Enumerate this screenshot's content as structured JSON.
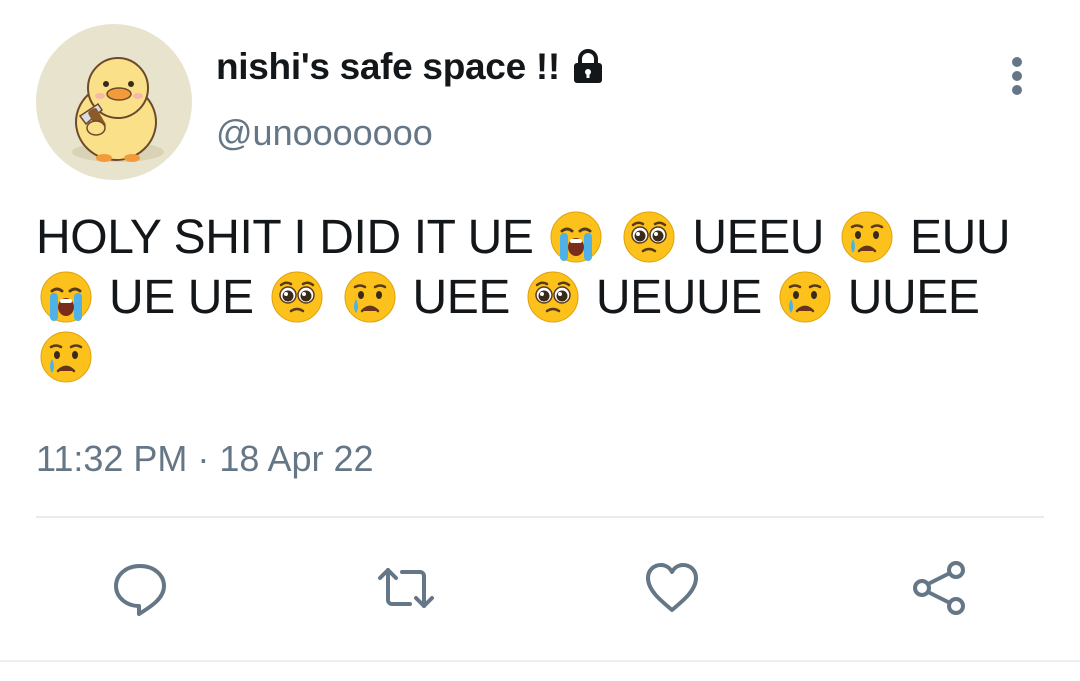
{
  "author": {
    "display_name": "nishi's safe space !!",
    "handle": "@unooooooo",
    "protected_icon": "lock-icon",
    "avatar_icon": "duck-with-knife-avatar"
  },
  "tweet": {
    "segments": [
      {
        "type": "text",
        "value": "HOLY SHIT I DID IT UE"
      },
      {
        "type": "emoji",
        "name": "loudly-crying-face-emoji"
      },
      {
        "type": "emoji",
        "name": "pleading-face-emoji"
      },
      {
        "type": "text",
        "value": "UEEU"
      },
      {
        "type": "emoji",
        "name": "crying-face-emoji"
      },
      {
        "type": "text",
        "value": "EUU"
      },
      {
        "type": "emoji",
        "name": "loudly-crying-face-emoji"
      },
      {
        "type": "text",
        "value": "UE UE"
      },
      {
        "type": "emoji",
        "name": "pleading-face-emoji"
      },
      {
        "type": "emoji",
        "name": "crying-face-emoji"
      },
      {
        "type": "text",
        "value": "UEE"
      },
      {
        "type": "emoji",
        "name": "pleading-face-emoji"
      },
      {
        "type": "text",
        "value": "UEUUE"
      },
      {
        "type": "emoji",
        "name": "crying-face-emoji"
      },
      {
        "type": "text",
        "value": "UUEE"
      },
      {
        "type": "emoji",
        "name": "crying-face-emoji"
      }
    ],
    "timestamp": "11:32 PM · 18 Apr 22"
  },
  "actions": [
    {
      "name": "reply-icon"
    },
    {
      "name": "retweet-icon"
    },
    {
      "name": "like-icon"
    },
    {
      "name": "share-icon"
    }
  ],
  "colors": {
    "text_primary": "#14171a",
    "text_secondary": "#657786",
    "icon_gray": "#657786",
    "divider": "#e6ecf0",
    "emoji_yellow": "#fcc21b",
    "avatar_bg": "#e8e3cc"
  }
}
